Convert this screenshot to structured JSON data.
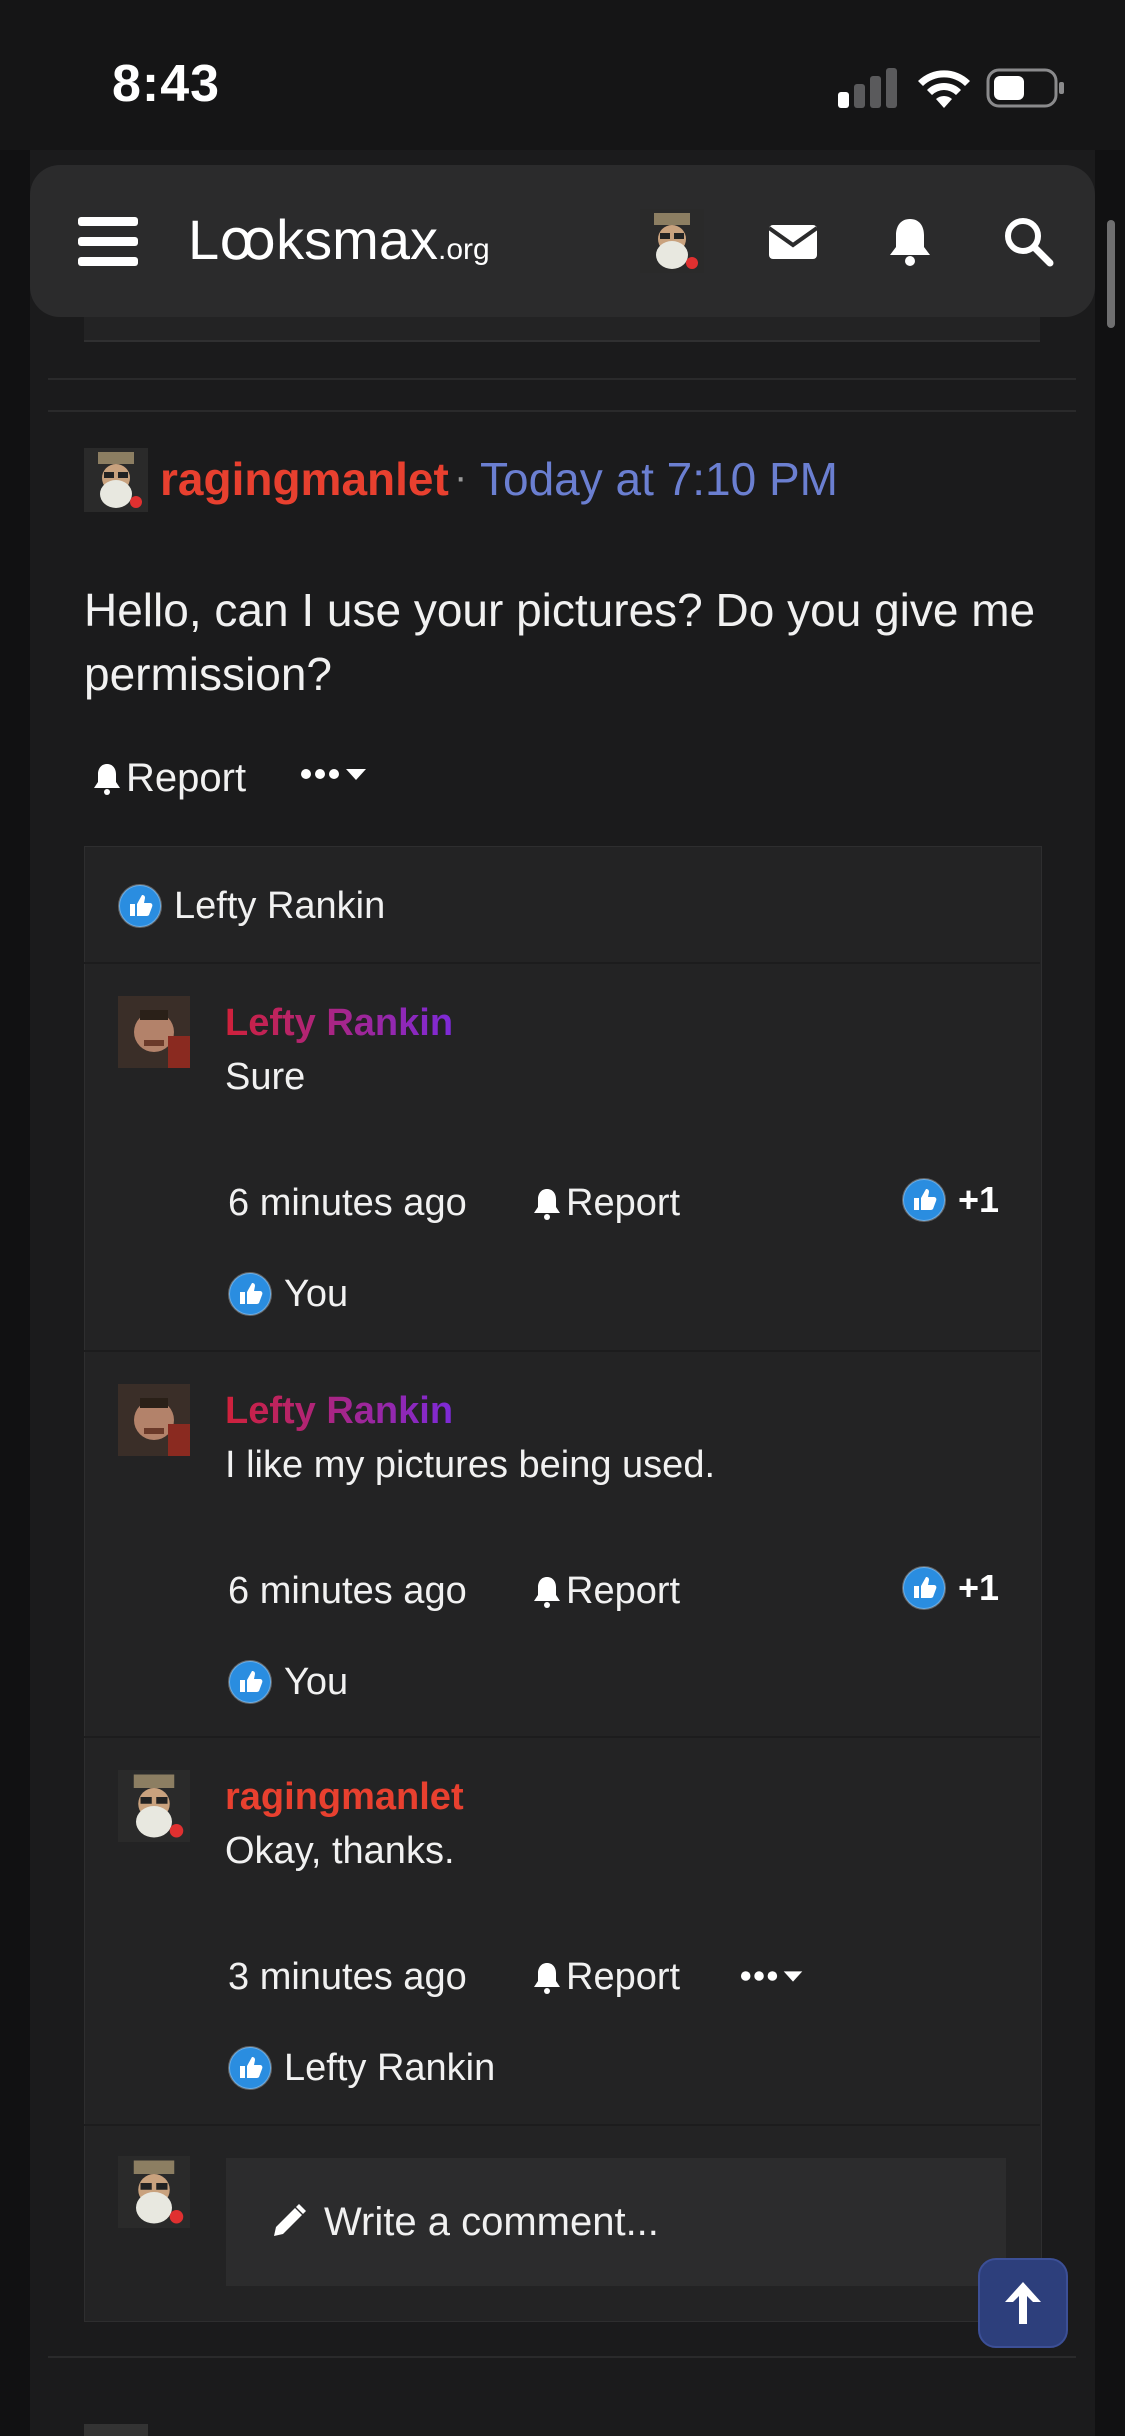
{
  "status_bar": {
    "time": "8:43"
  },
  "header": {
    "logo_main": "Lꝏksmax",
    "logo_suffix": ".org"
  },
  "post": {
    "author": "ragingmanlet",
    "separator": "·",
    "timestamp": "Today at 7:10 PM",
    "body": "Hello, can I use your pictures? Do you give me permission?",
    "report_label": "Report",
    "reactor": "Lefty Rankin"
  },
  "comments": [
    {
      "author": "Lefty Rankin",
      "text": "Sure",
      "time": "6 minutes ago",
      "report_label": "Report",
      "like_count": "+1",
      "reactor": "You"
    },
    {
      "author": "Lefty Rankin",
      "text": "I like my pictures being used.",
      "time": "6 minutes ago",
      "report_label": "Report",
      "like_count": "+1",
      "reactor": "You"
    },
    {
      "author": "ragingmanlet",
      "text": "Okay, thanks.",
      "time": "3 minutes ago",
      "report_label": "Report",
      "reactor": "Lefty Rankin"
    }
  ],
  "composer": {
    "placeholder": "Write a comment..."
  },
  "colors": {
    "author_red": "#e8402f",
    "time_link": "#6b7fd1",
    "like_blue": "#2a8de0"
  },
  "icons": [
    "menu-icon",
    "envelope-icon",
    "bell-icon",
    "search-icon",
    "like-icon",
    "pencil-icon",
    "arrow-up-icon",
    "ellipsis-icon",
    "caret-down-icon"
  ]
}
